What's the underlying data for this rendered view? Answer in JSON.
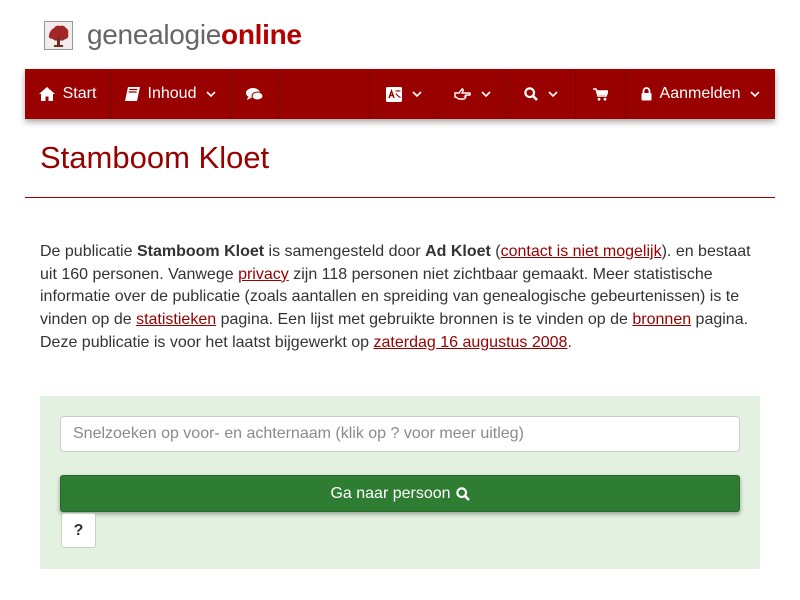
{
  "logo": {
    "part1": "genealogie",
    "part2": "online"
  },
  "nav": {
    "start": "Start",
    "contents": "Inhoud",
    "login": "Aanmelden"
  },
  "title": "Stamboom Kloet",
  "intro": {
    "t1": "De publicatie ",
    "pub": "Stamboom Kloet",
    "t2": " is samengesteld door ",
    "author": "Ad Kloet",
    "t3": " (",
    "contact": "contact is niet mogelijk",
    "t4": "). en bestaat uit 160 personen. Vanwege ",
    "privacy": "privacy",
    "t5": " zijn 118 personen niet zichtbaar gemaakt. Meer statistische informatie over de publicatie (zoals aantallen en spreiding van genealogische gebeurtenissen) is te vinden op de ",
    "stats": "statistieken",
    "t6": " pagina. Een lijst met gebruikte bronnen is te vinden op de ",
    "sources": "bronnen",
    "t7": " pagina. Deze publicatie is voor het laatst bijgewerkt op ",
    "date": "zaterdag 16 augustus 2008",
    "t8": "."
  },
  "search": {
    "placeholder": "Snelzoeken op voor- en achternaam (klik op ? voor meer uitleg)",
    "button": "Ga naar persoon",
    "help": "?"
  },
  "icons": {
    "tree": "tree-icon",
    "home": "home-icon",
    "book": "book-icon",
    "comments": "comments-icon",
    "translate": "translate-icon",
    "hand": "hand-pointer-icon",
    "search": "search-icon",
    "cart": "cart-icon",
    "lock": "lock-icon"
  },
  "colors": {
    "brand": "#990000",
    "button_green": "#2f7d32",
    "panel": "#e3f1e0"
  }
}
